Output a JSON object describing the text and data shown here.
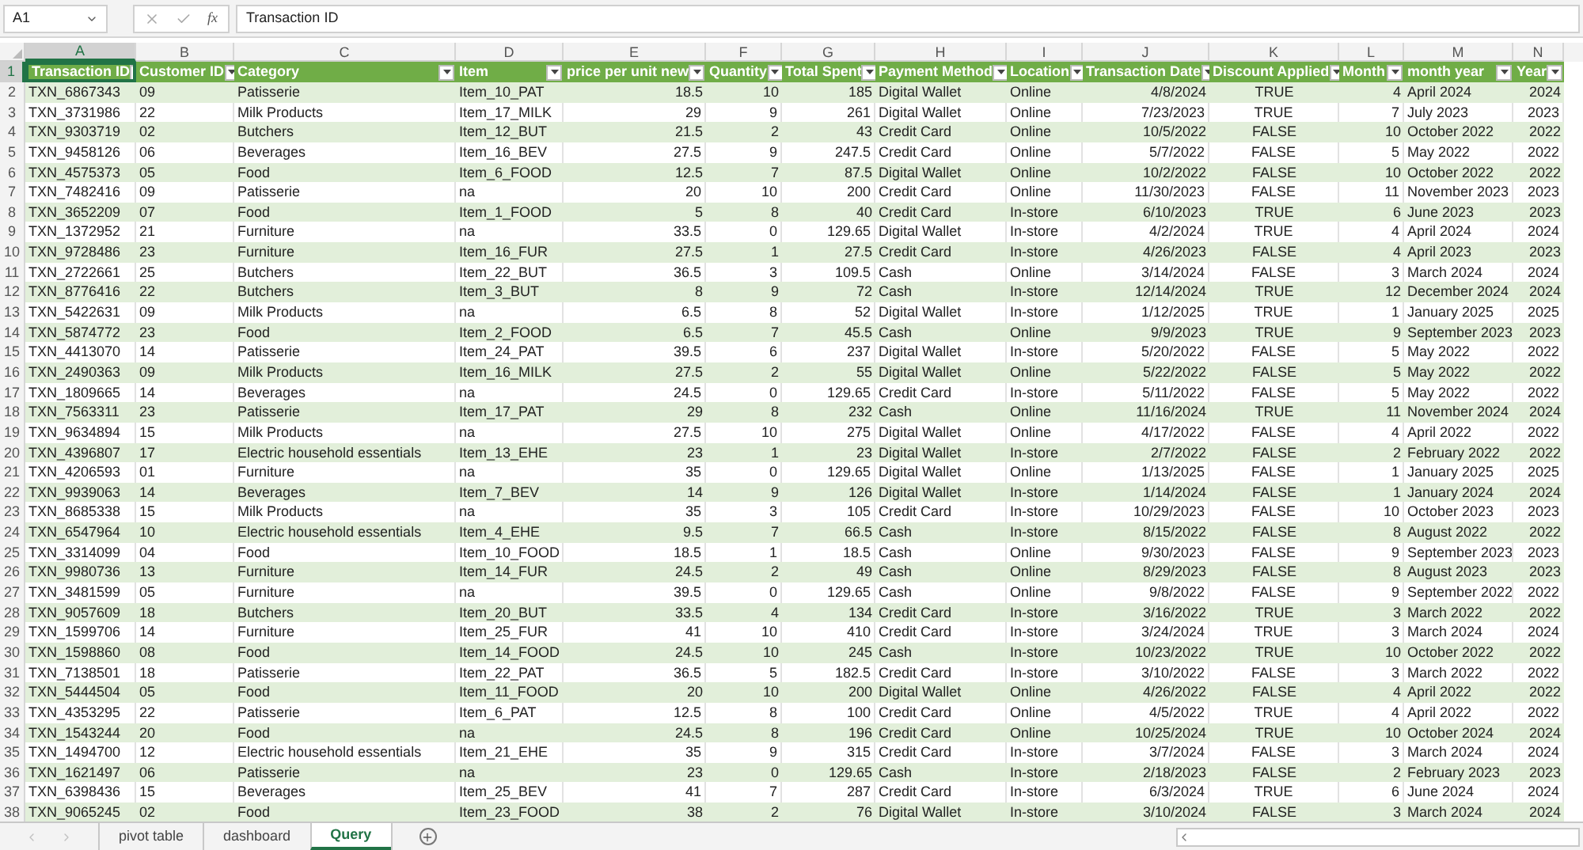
{
  "formula_bar": {
    "name_box": "A1",
    "function_label": "fx",
    "formula": "Transaction ID"
  },
  "columns": [
    {
      "letter": "A",
      "header": "Transaction ID",
      "selected": true
    },
    {
      "letter": "B",
      "header": "Customer ID",
      "selected": false
    },
    {
      "letter": "C",
      "header": "Category",
      "selected": false
    },
    {
      "letter": "D",
      "header": "Item",
      "selected": false
    },
    {
      "letter": "E",
      "header": "price per unit new",
      "selected": false
    },
    {
      "letter": "F",
      "header": "Quantity",
      "selected": false
    },
    {
      "letter": "G",
      "header": "Total Spent",
      "selected": false
    },
    {
      "letter": "H",
      "header": "Payment Method",
      "selected": false
    },
    {
      "letter": "I",
      "header": "Location",
      "selected": false
    },
    {
      "letter": "J",
      "header": "Transaction Date",
      "selected": false
    },
    {
      "letter": "K",
      "header": "Discount Applied",
      "selected": false
    },
    {
      "letter": "L",
      "header": "Month",
      "selected": false
    },
    {
      "letter": "M",
      "header": "month year",
      "selected": false
    },
    {
      "letter": "N",
      "header": "Year",
      "selected": false
    }
  ],
  "header_row_number": "1",
  "rows": [
    {
      "number": "2",
      "cells": [
        "TXN_6867343",
        "09",
        "Patisserie",
        "Item_10_PAT",
        "18.5",
        "10",
        "185",
        "Digital Wallet",
        "Online",
        "4/8/2024",
        "TRUE",
        "4",
        "April 2024",
        "2024"
      ]
    },
    {
      "number": "3",
      "cells": [
        "TXN_3731986",
        "22",
        "Milk Products",
        "Item_17_MILK",
        "29",
        "9",
        "261",
        "Digital Wallet",
        "Online",
        "7/23/2023",
        "TRUE",
        "7",
        "July 2023",
        "2023"
      ]
    },
    {
      "number": "4",
      "cells": [
        "TXN_9303719",
        "02",
        "Butchers",
        "Item_12_BUT",
        "21.5",
        "2",
        "43",
        "Credit Card",
        "Online",
        "10/5/2022",
        "FALSE",
        "10",
        "October 2022",
        "2022"
      ]
    },
    {
      "number": "5",
      "cells": [
        "TXN_9458126",
        "06",
        "Beverages",
        "Item_16_BEV",
        "27.5",
        "9",
        "247.5",
        "Credit Card",
        "Online",
        "5/7/2022",
        "FALSE",
        "5",
        "May 2022",
        "2022"
      ]
    },
    {
      "number": "6",
      "cells": [
        "TXN_4575373",
        "05",
        "Food",
        "Item_6_FOOD",
        "12.5",
        "7",
        "87.5",
        "Digital Wallet",
        "Online",
        "10/2/2022",
        "FALSE",
        "10",
        "October 2022",
        "2022"
      ]
    },
    {
      "number": "7",
      "cells": [
        "TXN_7482416",
        "09",
        "Patisserie",
        "na",
        "20",
        "10",
        "200",
        "Credit Card",
        "Online",
        "11/30/2023",
        "FALSE",
        "11",
        "November 2023",
        "2023"
      ]
    },
    {
      "number": "8",
      "cells": [
        "TXN_3652209",
        "07",
        "Food",
        "Item_1_FOOD",
        "5",
        "8",
        "40",
        "Credit Card",
        "In-store",
        "6/10/2023",
        "TRUE",
        "6",
        "June 2023",
        "2023"
      ]
    },
    {
      "number": "9",
      "cells": [
        "TXN_1372952",
        "21",
        "Furniture",
        "na",
        "33.5",
        "0",
        "129.65",
        "Digital Wallet",
        "In-store",
        "4/2/2024",
        "TRUE",
        "4",
        "April 2024",
        "2024"
      ]
    },
    {
      "number": "10",
      "cells": [
        "TXN_9728486",
        "23",
        "Furniture",
        "Item_16_FUR",
        "27.5",
        "1",
        "27.5",
        "Credit Card",
        "In-store",
        "4/26/2023",
        "FALSE",
        "4",
        "April 2023",
        "2023"
      ]
    },
    {
      "number": "11",
      "cells": [
        "TXN_2722661",
        "25",
        "Butchers",
        "Item_22_BUT",
        "36.5",
        "3",
        "109.5",
        "Cash",
        "Online",
        "3/14/2024",
        "FALSE",
        "3",
        "March 2024",
        "2024"
      ]
    },
    {
      "number": "12",
      "cells": [
        "TXN_8776416",
        "22",
        "Butchers",
        "Item_3_BUT",
        "8",
        "9",
        "72",
        "Cash",
        "In-store",
        "12/14/2024",
        "TRUE",
        "12",
        "December 2024",
        "2024"
      ]
    },
    {
      "number": "13",
      "cells": [
        "TXN_5422631",
        "09",
        "Milk Products",
        "na",
        "6.5",
        "8",
        "52",
        "Digital Wallet",
        "In-store",
        "1/12/2025",
        "TRUE",
        "1",
        "January 2025",
        "2025"
      ]
    },
    {
      "number": "14",
      "cells": [
        "TXN_5874772",
        "23",
        "Food",
        "Item_2_FOOD",
        "6.5",
        "7",
        "45.5",
        "Cash",
        "Online",
        "9/9/2023",
        "TRUE",
        "9",
        "September 2023",
        "2023"
      ]
    },
    {
      "number": "15",
      "cells": [
        "TXN_4413070",
        "14",
        "Patisserie",
        "Item_24_PAT",
        "39.5",
        "6",
        "237",
        "Digital Wallet",
        "In-store",
        "5/20/2022",
        "FALSE",
        "5",
        "May 2022",
        "2022"
      ]
    },
    {
      "number": "16",
      "cells": [
        "TXN_2490363",
        "09",
        "Milk Products",
        "Item_16_MILK",
        "27.5",
        "2",
        "55",
        "Digital Wallet",
        "Online",
        "5/22/2022",
        "FALSE",
        "5",
        "May 2022",
        "2022"
      ]
    },
    {
      "number": "17",
      "cells": [
        "TXN_1809665",
        "14",
        "Beverages",
        "na",
        "24.5",
        "0",
        "129.65",
        "Credit Card",
        "In-store",
        "5/11/2022",
        "FALSE",
        "5",
        "May 2022",
        "2022"
      ]
    },
    {
      "number": "18",
      "cells": [
        "TXN_7563311",
        "23",
        "Patisserie",
        "Item_17_PAT",
        "29",
        "8",
        "232",
        "Cash",
        "Online",
        "11/16/2024",
        "TRUE",
        "11",
        "November 2024",
        "2024"
      ]
    },
    {
      "number": "19",
      "cells": [
        "TXN_9634894",
        "15",
        "Milk Products",
        "na",
        "27.5",
        "10",
        "275",
        "Digital Wallet",
        "Online",
        "4/17/2022",
        "FALSE",
        "4",
        "April 2022",
        "2022"
      ]
    },
    {
      "number": "20",
      "cells": [
        "TXN_4396807",
        "17",
        "Electric household essentials",
        "Item_13_EHE",
        "23",
        "1",
        "23",
        "Digital Wallet",
        "In-store",
        "2/7/2022",
        "FALSE",
        "2",
        "February 2022",
        "2022"
      ]
    },
    {
      "number": "21",
      "cells": [
        "TXN_4206593",
        "01",
        "Furniture",
        "na",
        "35",
        "0",
        "129.65",
        "Digital Wallet",
        "Online",
        "1/13/2025",
        "FALSE",
        "1",
        "January 2025",
        "2025"
      ]
    },
    {
      "number": "22",
      "cells": [
        "TXN_9939063",
        "14",
        "Beverages",
        "Item_7_BEV",
        "14",
        "9",
        "126",
        "Digital Wallet",
        "In-store",
        "1/14/2024",
        "FALSE",
        "1",
        "January 2024",
        "2024"
      ]
    },
    {
      "number": "23",
      "cells": [
        "TXN_8685338",
        "15",
        "Milk Products",
        "na",
        "35",
        "3",
        "105",
        "Credit Card",
        "In-store",
        "10/29/2023",
        "FALSE",
        "10",
        "October 2023",
        "2023"
      ]
    },
    {
      "number": "24",
      "cells": [
        "TXN_6547964",
        "10",
        "Electric household essentials",
        "Item_4_EHE",
        "9.5",
        "7",
        "66.5",
        "Cash",
        "In-store",
        "8/15/2022",
        "FALSE",
        "8",
        "August 2022",
        "2022"
      ]
    },
    {
      "number": "25",
      "cells": [
        "TXN_3314099",
        "04",
        "Food",
        "Item_10_FOOD",
        "18.5",
        "1",
        "18.5",
        "Cash",
        "Online",
        "9/30/2023",
        "FALSE",
        "9",
        "September 2023",
        "2023"
      ]
    },
    {
      "number": "26",
      "cells": [
        "TXN_9980736",
        "13",
        "Furniture",
        "Item_14_FUR",
        "24.5",
        "2",
        "49",
        "Cash",
        "Online",
        "8/29/2023",
        "FALSE",
        "8",
        "August 2023",
        "2023"
      ]
    },
    {
      "number": "27",
      "cells": [
        "TXN_3481599",
        "05",
        "Furniture",
        "na",
        "39.5",
        "0",
        "129.65",
        "Cash",
        "Online",
        "9/8/2022",
        "FALSE",
        "9",
        "September 2022",
        "2022"
      ]
    },
    {
      "number": "28",
      "cells": [
        "TXN_9057609",
        "18",
        "Butchers",
        "Item_20_BUT",
        "33.5",
        "4",
        "134",
        "Credit Card",
        "In-store",
        "3/16/2022",
        "TRUE",
        "3",
        "March 2022",
        "2022"
      ]
    },
    {
      "number": "29",
      "cells": [
        "TXN_1599706",
        "14",
        "Furniture",
        "Item_25_FUR",
        "41",
        "10",
        "410",
        "Credit Card",
        "In-store",
        "3/24/2024",
        "TRUE",
        "3",
        "March 2024",
        "2024"
      ]
    },
    {
      "number": "30",
      "cells": [
        "TXN_1598860",
        "08",
        "Food",
        "Item_14_FOOD",
        "24.5",
        "10",
        "245",
        "Cash",
        "In-store",
        "10/23/2022",
        "TRUE",
        "10",
        "October 2022",
        "2022"
      ]
    },
    {
      "number": "31",
      "cells": [
        "TXN_7138501",
        "18",
        "Patisserie",
        "Item_22_PAT",
        "36.5",
        "5",
        "182.5",
        "Credit Card",
        "In-store",
        "3/10/2022",
        "FALSE",
        "3",
        "March 2022",
        "2022"
      ]
    },
    {
      "number": "32",
      "cells": [
        "TXN_5444504",
        "05",
        "Food",
        "Item_11_FOOD",
        "20",
        "10",
        "200",
        "Digital Wallet",
        "Online",
        "4/26/2022",
        "FALSE",
        "4",
        "April 2022",
        "2022"
      ]
    },
    {
      "number": "33",
      "cells": [
        "TXN_4353295",
        "22",
        "Patisserie",
        "Item_6_PAT",
        "12.5",
        "8",
        "100",
        "Credit Card",
        "Online",
        "4/5/2022",
        "TRUE",
        "4",
        "April 2022",
        "2022"
      ]
    },
    {
      "number": "34",
      "cells": [
        "TXN_1543244",
        "20",
        "Food",
        "na",
        "24.5",
        "8",
        "196",
        "Credit Card",
        "Online",
        "10/25/2024",
        "TRUE",
        "10",
        "October 2024",
        "2024"
      ]
    },
    {
      "number": "35",
      "cells": [
        "TXN_1494700",
        "12",
        "Electric household essentials",
        "Item_21_EHE",
        "35",
        "9",
        "315",
        "Credit Card",
        "In-store",
        "3/7/2024",
        "FALSE",
        "3",
        "March 2024",
        "2024"
      ]
    },
    {
      "number": "36",
      "cells": [
        "TXN_1621497",
        "06",
        "Patisserie",
        "na",
        "23",
        "0",
        "129.65",
        "Cash",
        "In-store",
        "2/18/2023",
        "FALSE",
        "2",
        "February 2023",
        "2023"
      ]
    },
    {
      "number": "37",
      "cells": [
        "TXN_6398436",
        "15",
        "Beverages",
        "Item_25_BEV",
        "41",
        "7",
        "287",
        "Credit Card",
        "In-store",
        "6/3/2024",
        "TRUE",
        "6",
        "June 2024",
        "2024"
      ]
    },
    {
      "number": "38",
      "cells": [
        "TXN_9065245",
        "02",
        "Food",
        "Item_23_FOOD",
        "38",
        "2",
        "76",
        "Digital Wallet",
        "In-store",
        "3/10/2024",
        "FALSE",
        "3",
        "March 2024",
        "2024"
      ]
    }
  ],
  "sheet_tabs": [
    {
      "label": "pivot table",
      "selected": false
    },
    {
      "label": "dashboard",
      "selected": false
    },
    {
      "label": "Query",
      "selected": true
    }
  ]
}
